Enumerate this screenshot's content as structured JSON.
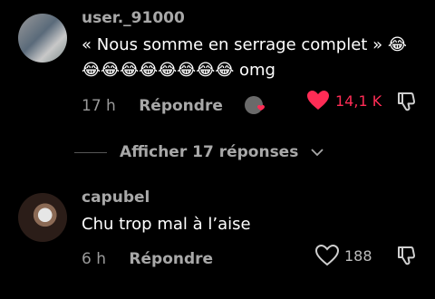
{
  "comments": [
    {
      "username": "user._91000",
      "text_line1": "« Nous somme en serrage complet » 😂",
      "text_line2": "😂😂😂😂😂😂😂😂 omg",
      "time": "17 h",
      "reply_label": "Répondre",
      "like_count": "14,1 K",
      "liked": true,
      "accent_color": "#fe2c55"
    },
    {
      "username": "capubel",
      "text_line1": "Chu trop mal à l’aise",
      "time": "6 h",
      "reply_label": "Répondre",
      "like_count": "188",
      "liked": false
    }
  ],
  "view_replies_label": "Afficher 17 réponses",
  "icons": {
    "like_filled": "heart-filled-icon",
    "like_outline": "heart-outline-icon",
    "dislike": "dislike-icon",
    "chevron": "chevron-down-icon"
  }
}
